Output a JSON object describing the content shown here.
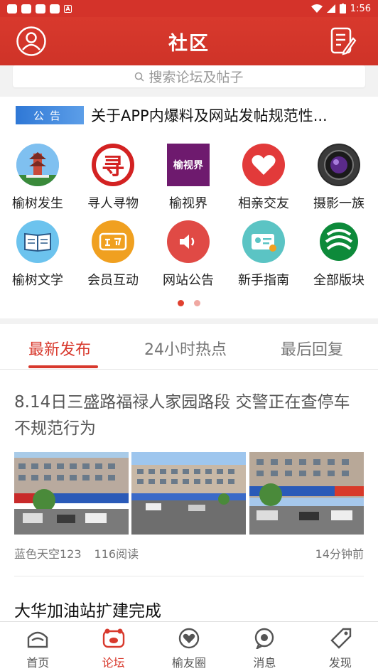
{
  "status_bar": {
    "time": "1:56"
  },
  "header": {
    "title": "社区"
  },
  "search": {
    "placeholder": "搜索论坛及帖子"
  },
  "notice": {
    "badge": "公告",
    "text": "关于APP内爆料及网站发帖规范性..."
  },
  "grid": {
    "items": [
      {
        "label": "榆树发生",
        "icon": "pagoda-icon",
        "color": "#3a7fc1"
      },
      {
        "label": "寻人寻物",
        "icon": "xun-character-icon",
        "color": "#d32222"
      },
      {
        "label": "榆视界",
        "icon": "yushijie-logo-icon",
        "color": "#8a1f8a"
      },
      {
        "label": "相亲交友",
        "icon": "heart-icon",
        "color": "#e23a3a"
      },
      {
        "label": "摄影一族",
        "icon": "camera-lens-icon",
        "color": "#333333"
      },
      {
        "label": "榆树文学",
        "icon": "book-icon",
        "color": "#6cc3ee"
      },
      {
        "label": "会员互动",
        "icon": "interact-icon",
        "color": "#f0a020"
      },
      {
        "label": "网站公告",
        "icon": "speaker-icon",
        "color": "#e04a45"
      },
      {
        "label": "新手指南",
        "icon": "id-card-icon",
        "color": "#5bc4c4"
      },
      {
        "label": "全部版块",
        "icon": "all-sections-icon",
        "color": "#0d8a3a"
      }
    ],
    "xun_char": "寻",
    "yushijie_text": "榆视界"
  },
  "tabs": [
    {
      "label": "最新发布",
      "active": true
    },
    {
      "label": "24小时热点",
      "active": false
    },
    {
      "label": "最后回复",
      "active": false
    }
  ],
  "posts": [
    {
      "title": "8.14日三盛路福禄人家园路段  交警正在查停车不规范行为",
      "author": "蓝色天空123",
      "reads": "116阅读",
      "time": "14分钟前"
    },
    {
      "title": "大华加油站扩建完成"
    }
  ],
  "bottom_nav": [
    {
      "label": "首页",
      "icon": "home-icon",
      "active": false
    },
    {
      "label": "论坛",
      "icon": "forum-icon",
      "active": true
    },
    {
      "label": "榆友圈",
      "icon": "heart-circle-icon",
      "active": false
    },
    {
      "label": "消息",
      "icon": "message-icon",
      "active": false
    },
    {
      "label": "发现",
      "icon": "discover-icon",
      "active": false
    }
  ],
  "colors": {
    "brand": "#d8392d"
  }
}
